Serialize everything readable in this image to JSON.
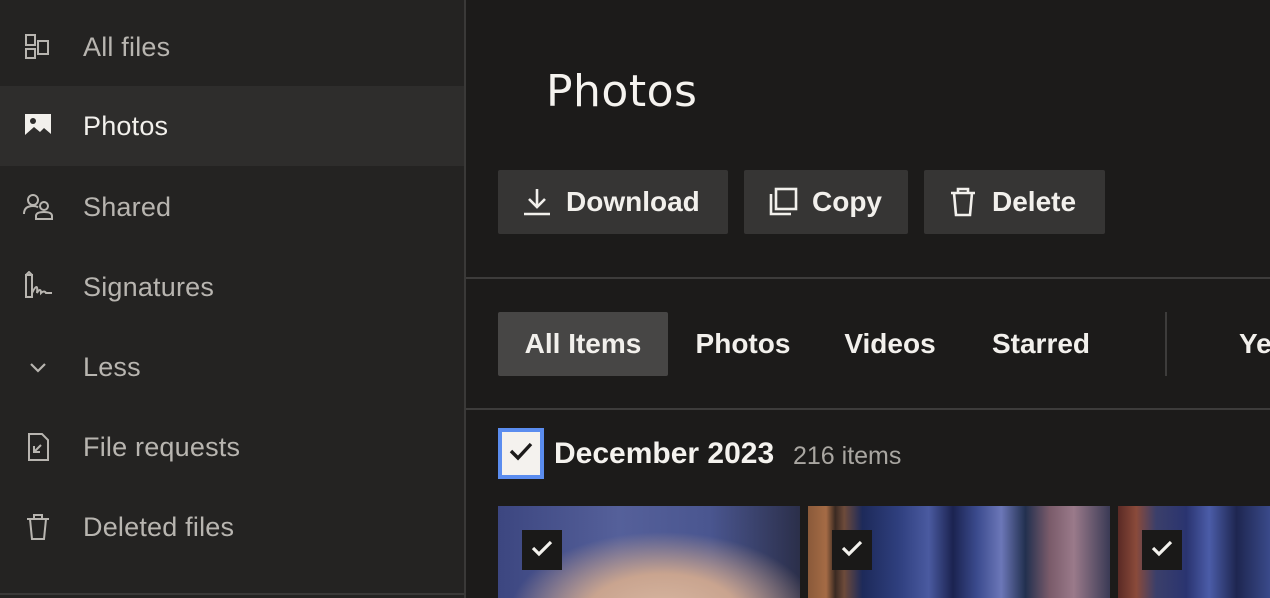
{
  "sidebar": {
    "items": [
      {
        "label": "All files",
        "icon": "all-files-icon",
        "active": false
      },
      {
        "label": "Photos",
        "icon": "photos-icon",
        "active": true
      },
      {
        "label": "Shared",
        "icon": "shared-icon",
        "active": false
      },
      {
        "label": "Signatures",
        "icon": "signatures-icon",
        "active": false
      },
      {
        "label": "Less",
        "icon": "chevron-down-icon",
        "active": false
      },
      {
        "label": "File requests",
        "icon": "file-requests-icon",
        "active": false
      },
      {
        "label": "Deleted files",
        "icon": "trash-icon",
        "active": false
      }
    ]
  },
  "main": {
    "title": "Photos",
    "toolbar": {
      "download_label": "Download",
      "copy_label": "Copy",
      "delete_label": "Delete"
    },
    "filters": {
      "tabs": [
        {
          "label": "All Items",
          "active": true
        },
        {
          "label": "Photos",
          "active": false
        },
        {
          "label": "Videos",
          "active": false
        },
        {
          "label": "Starred",
          "active": false
        },
        {
          "label": "Ye",
          "active": false
        }
      ]
    },
    "group": {
      "title": "December 2023",
      "count": "216 items",
      "selected": true
    },
    "thumbnails": [
      {
        "selected": true
      },
      {
        "selected": true
      },
      {
        "selected": true
      }
    ]
  },
  "colors": {
    "sidebar_bg": "#242322",
    "main_bg": "#1c1b1a",
    "button_bg": "#363534",
    "active_tab_bg": "#474645",
    "checkbox_focus": "#5b8def",
    "text_primary": "#f2f0ec",
    "text_secondary": "#b8b5b0"
  }
}
